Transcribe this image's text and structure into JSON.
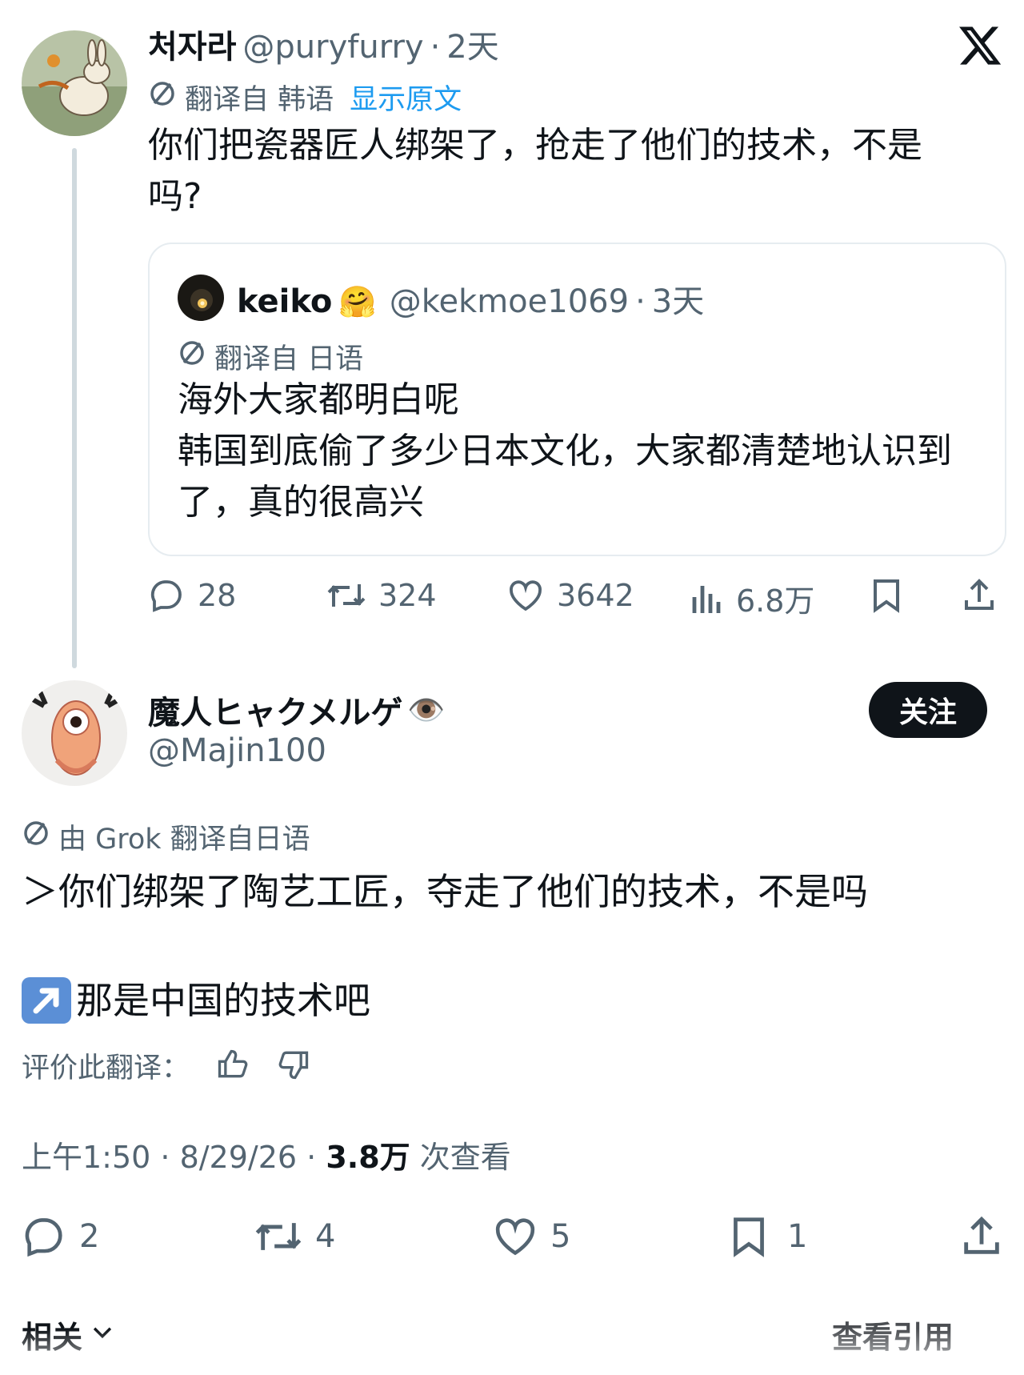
{
  "x_logo": "𝕏",
  "reply_tweet": {
    "author_name": "처자라",
    "handle": "@puryfurry",
    "separator": "·",
    "time": "2天",
    "translated_from": "翻译自 韩语",
    "show_original": "显示原文",
    "text": "你们把瓷器匠人绑架了，抢走了他们的技术，不是\n吗?",
    "quote": {
      "author_name": "keiko",
      "author_emoji": "🤗",
      "handle": "@kekmoe1069",
      "time": "3天",
      "translated_from": "翻译自 日语",
      "text": "海外大家都明白呢\n韩国到底偷了多少日本文化，大家都清楚地认识到\n了，真的很高兴"
    },
    "stats": {
      "replies": "28",
      "retweets": "324",
      "likes": "3642",
      "views": "6.8万"
    }
  },
  "main_tweet": {
    "author_name": "魔人ヒャクメルゲ",
    "author_emoji": "👁️",
    "handle": "@Majin100",
    "follow_label": "关注",
    "translated_by": "由 Grok 翻译自日语",
    "text_line1": "＞你们绑架了陶艺工匠，夺走了他们的技术，不是吗",
    "text_line2_emoji": "↗️",
    "text_line2": "那是中国的技术吧",
    "rate_translation": "评价此翻译：",
    "timestamp": "上午1:50 · 8/29/26 · ",
    "views_count": "3.8万",
    "views_label": " 次查看",
    "stats": {
      "replies": "2",
      "retweets": "4",
      "likes": "5",
      "bookmarks": "1"
    }
  },
  "footer": {
    "related_label": "相关",
    "right_label": "查看引用"
  }
}
